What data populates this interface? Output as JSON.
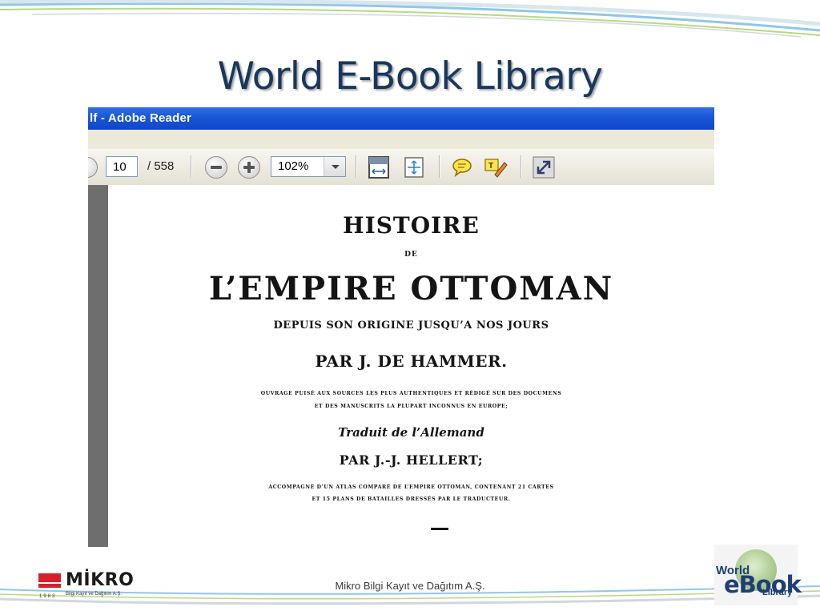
{
  "slide": {
    "title": "World E-Book Library",
    "footer": "Mikro Bilgi Kayıt ve Dağıtım A.Ş."
  },
  "reader": {
    "window_title": "lf - Adobe Reader",
    "page_current": "10",
    "page_total": "/ 558",
    "zoom": "102%"
  },
  "document": {
    "line1": "HISTOIRE",
    "line2": "DE",
    "line3": "L’EMPIRE OTTOMAN",
    "line4": "DEPUIS SON ORIGINE JUSQU’A NOS JOURS",
    "line5": "PAR J. DE HAMMER.",
    "line6": "OUVRAGE PUISÉ AUX SOURCES LES PLUS AUTHENTIQUES ET RÉDIGÉ SUR DES DOCUMENS",
    "line7": "ET DES MANUSCRITS LA PLUPART INCONNUS EN EUROPE;",
    "line8": "Traduit de l’Allemand",
    "line9": "PAR J.-J. HELLERT;",
    "line10": "ACCOMPAGNÉ D’UN ATLAS COMPARÉ DE L’EMPIRE OTTOMAN, CONTENANT 21 CARTES",
    "line11": "ET 15 PLANS DE BATAILLES DRESSÉS PAR LE TRADUCTEUR."
  },
  "logos": {
    "mikro_name": "MİKRO",
    "mikro_tagline": "Bilgi Kayıt ve Dağıtım A.Ş.",
    "mikro_year": "1983",
    "ebook_world": "World",
    "ebook_ebook": "eBook",
    "ebook_library": "Library"
  },
  "colors": {
    "title": "#17375e",
    "titlebar": "#1a55d6",
    "mikro_red": "#d6202b"
  }
}
